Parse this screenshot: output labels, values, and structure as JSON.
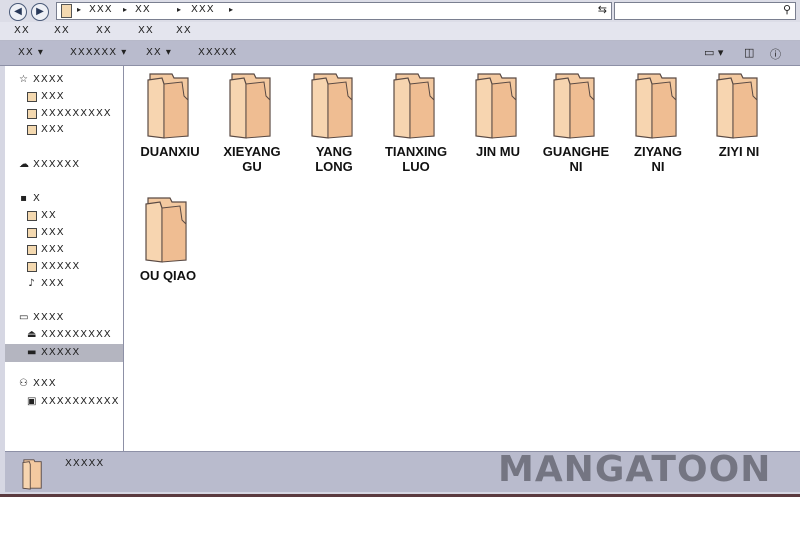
{
  "address": {
    "crumbs": [
      "XXX",
      "XX",
      "XXX"
    ]
  },
  "menu": [
    "XX",
    "XX",
    "XX",
    "XX",
    "XX"
  ],
  "toolbar": [
    "XX",
    "XXXXXX",
    "XX",
    "XXXXX"
  ],
  "sidebar": {
    "favorites": {
      "label": "XXXX",
      "items": [
        "XXX",
        "XXXXXXXXX",
        "XXX"
      ]
    },
    "group2": {
      "label": "XXXXXX"
    },
    "computer": {
      "label": "X",
      "items": [
        "XX",
        "XXX",
        "XXX",
        "XXXXX",
        "XXX"
      ]
    },
    "network": {
      "label": "XXXX",
      "items": [
        "XXXXXXXXX",
        "XXXXX"
      ]
    },
    "homegroup": {
      "label": "XXX",
      "items": [
        "XXXXXXXXXX"
      ]
    }
  },
  "folders": [
    {
      "line1": "DUANXIU",
      "line2": ""
    },
    {
      "line1": "XIEYANG",
      "line2": "GU"
    },
    {
      "line1": "YANG",
      "line2": "LONG"
    },
    {
      "line1": "TIANXING",
      "line2": "LUO"
    },
    {
      "line1": "JIN MU",
      "line2": ""
    },
    {
      "line1": "GUANGHE",
      "line2": "NI"
    },
    {
      "line1": "ZIYANG",
      "line2": "NI"
    },
    {
      "line1": "ZIYI NI",
      "line2": ""
    },
    {
      "line1": "OU QIAO",
      "line2": ""
    }
  ],
  "status": {
    "text": "XXXXX"
  },
  "watermark": "MANGATOON",
  "colors": {
    "folder": "#f3c9a0",
    "folder_edge": "#5a4a44",
    "chrome": "#b9bbcd"
  }
}
